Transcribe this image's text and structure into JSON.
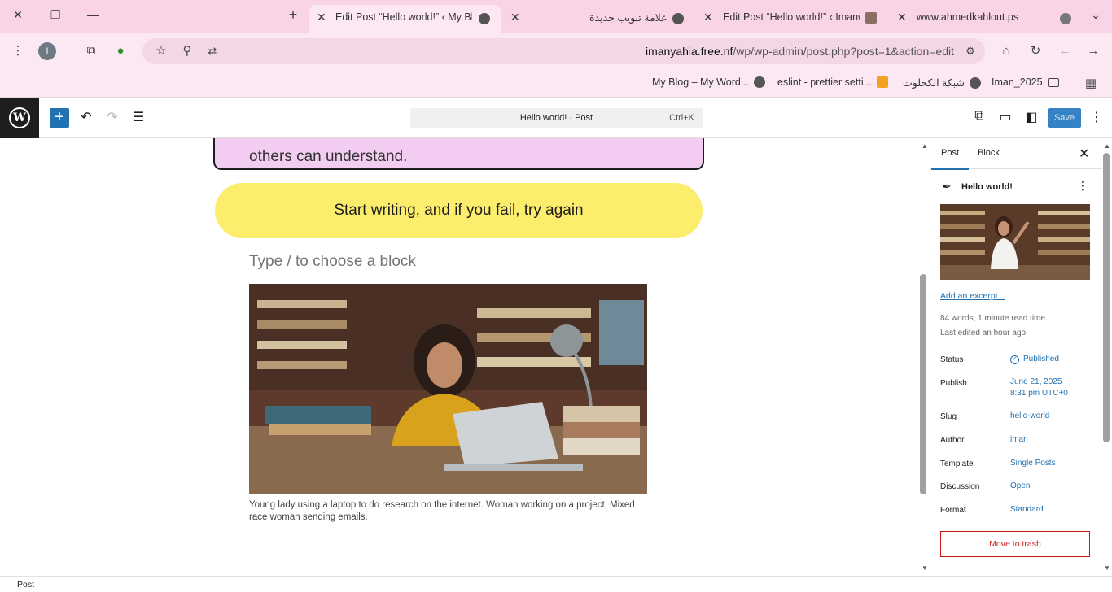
{
  "browser": {
    "tabs": [
      {
        "title": "www.ahmedkahlout.ps",
        "close": "✕"
      },
      {
        "title": "Edit Post “Hello world!” ‹ Imanw",
        "close": "✕"
      },
      {
        "title": "علامة تبويب جديدة",
        "close": "✕"
      },
      {
        "title": "Edit Post “Hello world!” ‹ My Blo",
        "close": "✕"
      }
    ],
    "new_tab": "+",
    "url_domain": "imanyahia.free.nf",
    "url_path": "/wp/wp-admin/post.php?post=1&action=edit",
    "profile_initial": "I",
    "bookmarks": [
      {
        "label": "My Blog – My Word..."
      },
      {
        "label": "eslint - prettier setti..."
      },
      {
        "label": "شبكة الكحلوت"
      },
      {
        "label": "Iman_2025"
      }
    ],
    "status_text": "Post"
  },
  "wp_toolbar": {
    "logo": "W",
    "add_block": "+",
    "command_title": "Hello world! · Post",
    "command_shortcut": "Ctrl+K",
    "save_label": "Save"
  },
  "editor": {
    "quote_text": "others can understand.",
    "button_text": "Start writing, and if you fail, try again",
    "placeholder": "Type / to choose a block",
    "image_caption": "Young lady using a laptop to do research on the internet. Woman working on a project. Mixed race woman sending emails."
  },
  "sidebar": {
    "tab_post": "Post",
    "tab_block": "Block",
    "close": "✕",
    "post_title": "Hello world!",
    "excerpt_link": "Add an excerpt...",
    "meta_words": "84 words, 1 minute read time.",
    "meta_edited": "Last edited an hour ago.",
    "rows": [
      {
        "label": "Status",
        "value": "Published"
      },
      {
        "label": "Publish",
        "value": "June 21, 2025",
        "value2": "8:31 pm UTC+0"
      },
      {
        "label": "Slug",
        "value": "hello-world"
      },
      {
        "label": "Author",
        "value": "iman"
      },
      {
        "label": "Template",
        "value": "Single Posts"
      },
      {
        "label": "Discussion",
        "value": "Open"
      },
      {
        "label": "Format",
        "value": "Standard"
      }
    ],
    "trash_label": "Move to trash"
  },
  "colors": {
    "wp_blue": "#2271b1",
    "quote_bg": "#f3cdf1",
    "button_bg": "#fcee6c",
    "chrome_bg": "#f9d3e6",
    "trash_red": "#cc1818"
  }
}
